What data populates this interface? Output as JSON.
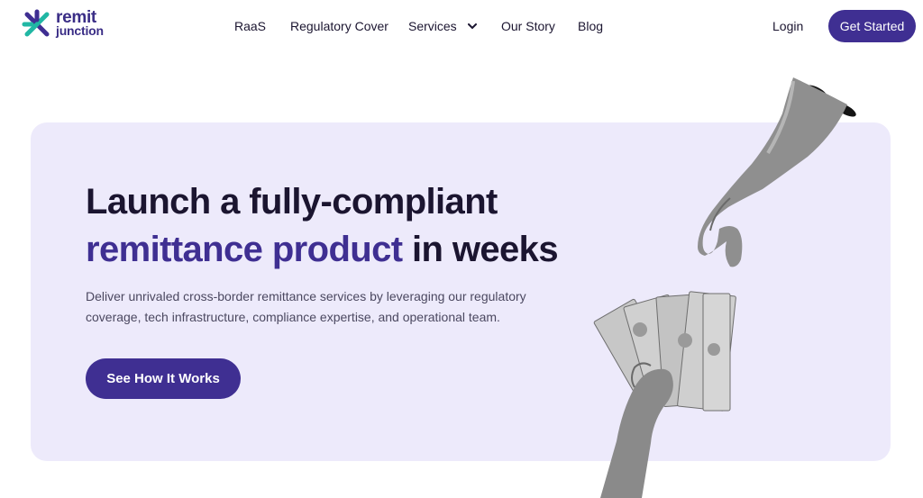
{
  "brand": {
    "line1": "remit",
    "line2": "junction",
    "primary_color": "#3f2f92",
    "hero_bg": "#edeafb"
  },
  "nav": {
    "items": [
      {
        "label": "RaaS"
      },
      {
        "label": "Regulatory Cover"
      },
      {
        "label": "Services",
        "has_dropdown": true
      },
      {
        "label": "Our Story"
      },
      {
        "label": "Blog"
      }
    ],
    "login_label": "Login",
    "cta_label": "Get Started"
  },
  "hero": {
    "headline_line1": "Launch a fully-compliant",
    "headline_accent": "remittance product",
    "headline_rest": " in weeks",
    "subtext": "Deliver unrivaled cross-border remittance services by leveraging our regulatory coverage, tech infrastructure, compliance expertise, and operational team.",
    "cta_label": "See How It Works"
  }
}
